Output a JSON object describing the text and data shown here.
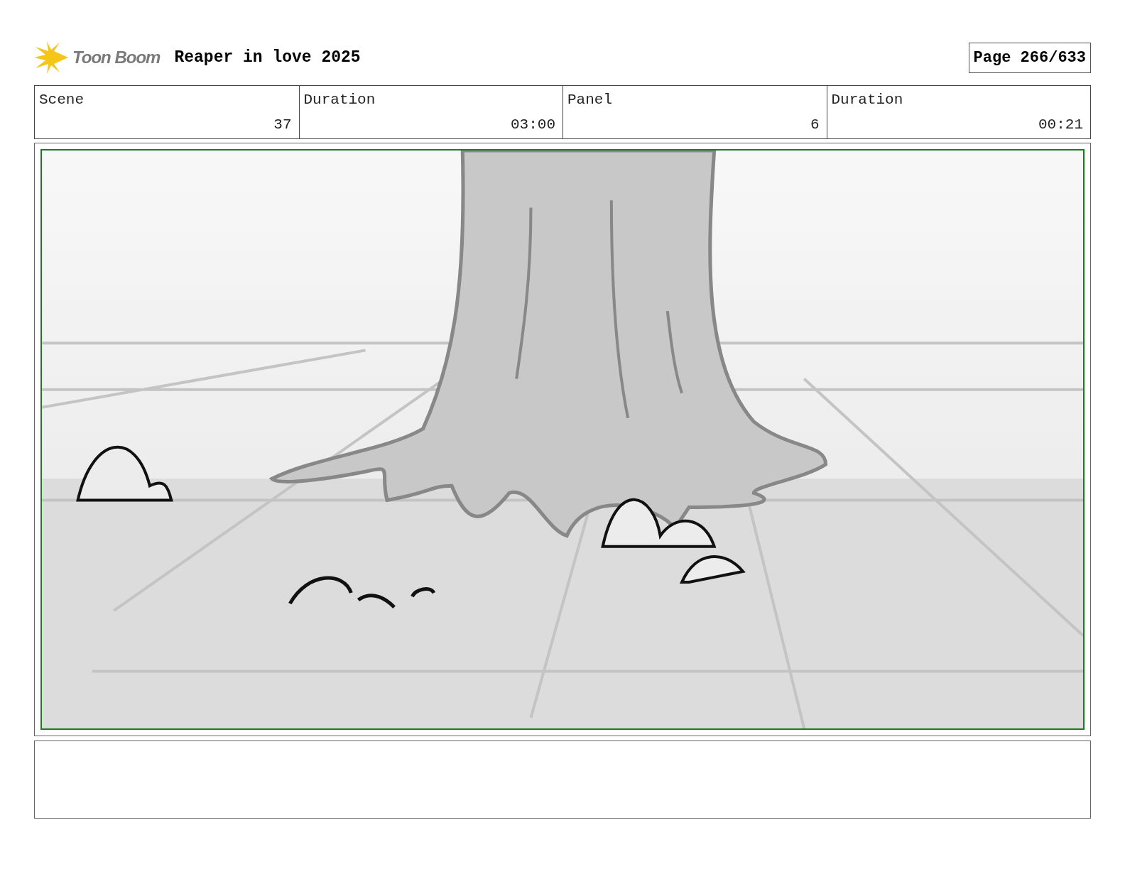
{
  "header": {
    "logo_text": "Toon Boom",
    "title": "Reaper in love 2025",
    "page": "Page 266/633"
  },
  "info_table": {
    "columns": [
      "Scene",
      "Duration",
      "Panel",
      "Duration"
    ],
    "rows": [
      [
        "37",
        "03:00",
        "6",
        "00:21"
      ]
    ]
  }
}
